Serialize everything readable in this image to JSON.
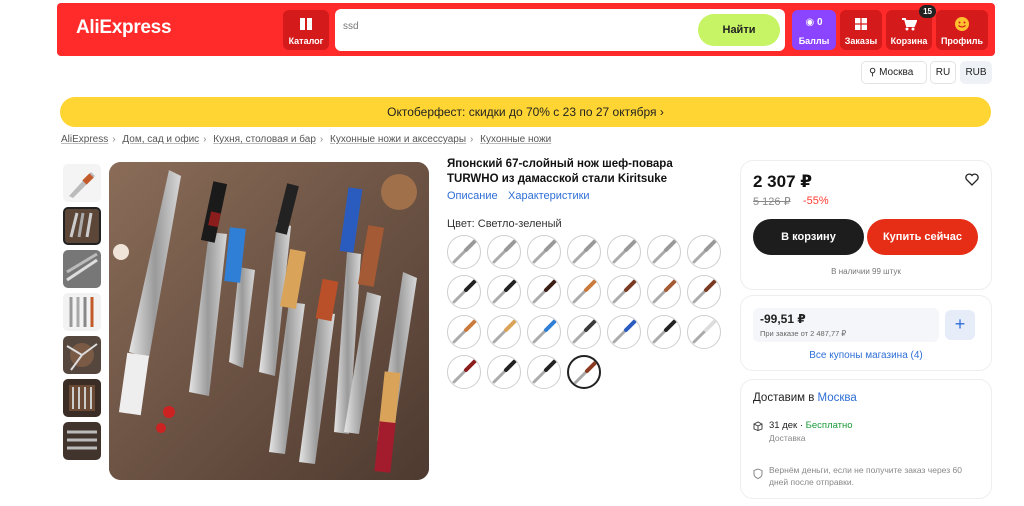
{
  "header": {
    "logo": "AliExpress",
    "catalog_label": "Каталог",
    "search_value": "ssd",
    "search_button": "Найти",
    "points_count": "0",
    "points_label": "Баллы",
    "orders_label": "Заказы",
    "cart_label": "Корзина",
    "cart_badge": "15",
    "profile_label": "Профиль",
    "brand_color": "#ff2a2a"
  },
  "locale": {
    "city": "Москва",
    "lang": "RU",
    "currency": "RUB"
  },
  "promo": "Октоберфест: скидки до 70% с 23 по 27 октября",
  "breadcrumbs": [
    "AliExpress",
    "Дом, сад и офис",
    "Кухня, столовая и бар",
    "Кухонные ножи и аксессуары",
    "Кухонные ножи"
  ],
  "product": {
    "title": "Японский 67-слойный нож шеф-повара TURWHO из дамасской стали Kiritsuke",
    "tabs": [
      "Описание",
      "Характеристики"
    ],
    "color_label": "Цвет: Светло-зеленый"
  },
  "price": {
    "current": "2 307 ₽",
    "old": "5 126 ₽",
    "discount": "-55%",
    "cart_button": "В корзину",
    "buy_button": "Купить сейчас",
    "stock": "В наличии 99 штук"
  },
  "coupon": {
    "amount": "-99,51 ₽",
    "condition": "При заказе от 2 487,77 ₽",
    "link": "Все купоны магазина (4)"
  },
  "delivery": {
    "title": "Доставим в",
    "city": "Москва",
    "date": "31 дек",
    "free": "Бесплатно",
    "date_sep": " · ",
    "sub": "Доставка",
    "refund": "Вернём деньги, если не получите заказ через 60 дней после отправки."
  }
}
